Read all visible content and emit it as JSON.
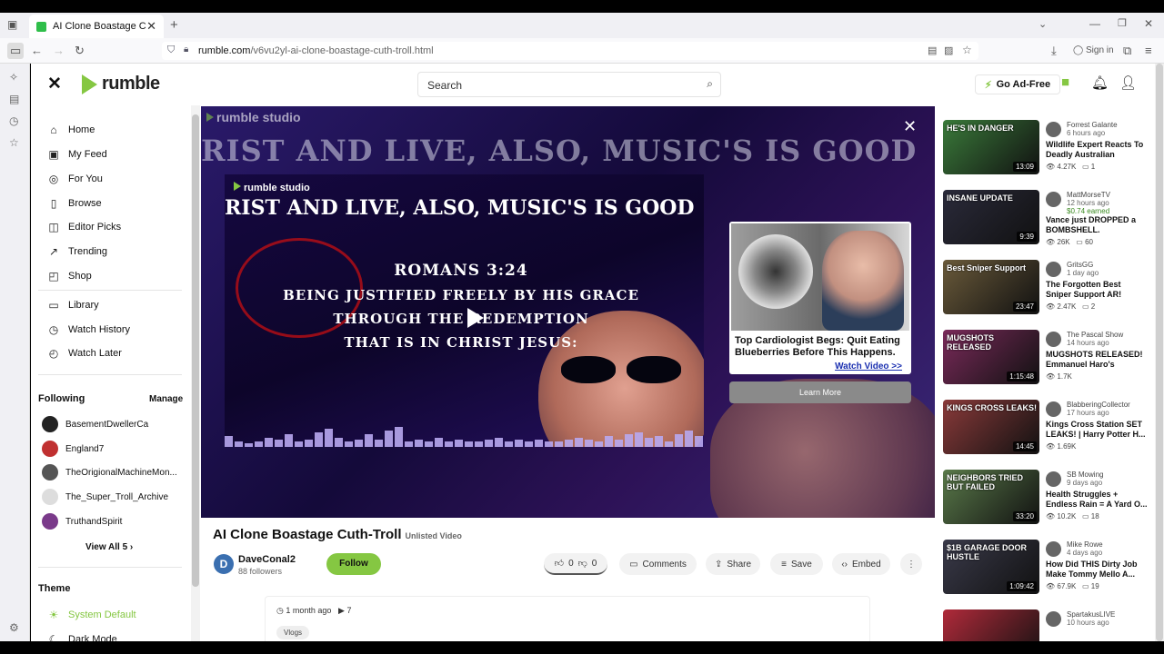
{
  "browser": {
    "tab_title": "AI Clone Boastage Cuth-Troll",
    "url_domain": "rumble.com",
    "url_path": "/v6vu2yl-ai-clone-boastage-cuth-troll.html",
    "sign_in": "Sign in"
  },
  "header": {
    "logo": "rumble",
    "search_placeholder": "Search",
    "ad_free": "Go Ad-Free"
  },
  "sidebar": {
    "nav": [
      "Home",
      "My Feed",
      "For You",
      "Browse",
      "Editor Picks",
      "Trending",
      "Shop"
    ],
    "library": [
      "Library",
      "Watch History",
      "Watch Later"
    ],
    "following_title": "Following",
    "manage": "Manage",
    "following": [
      "BasementDwellerCa",
      "England7",
      "TheOrigionalMachineMon...",
      "The_Super_Troll_Archive",
      "TruthandSpirit"
    ],
    "view_all": "View All 5",
    "theme_title": "Theme",
    "theme_options": [
      "System Default",
      "Dark Mode"
    ]
  },
  "video": {
    "studio_label": "rumble studio",
    "big_text": "RIST AND LIVE, ALSO, MUSIC'S IS GOOD",
    "inner_text": "RIST AND LIVE, ALSO, MUSIC'S IS GOOD",
    "verse_ref": "ROMANS 3:24",
    "verse_lines": [
      "BEING JUSTIFIED FREELY BY HIS GRACE",
      "THROUGH THE REDEMPTION",
      "THAT IS IN CHRIST JESUS:"
    ],
    "ad_headline": "Top Cardiologist Begs: Quit Eating Blueberries Before This Happens.",
    "ad_link": "Watch Video >>",
    "learn_more": "Learn More"
  },
  "details": {
    "title": "AI Clone Boastage Cuth-Troll",
    "unlisted": "Unlisted Video",
    "channel": "DaveConal2",
    "channel_initial": "D",
    "followers": "88 followers",
    "follow": "Follow",
    "likes": "0",
    "dislikes": "0",
    "comments": "Comments",
    "share": "Share",
    "save": "Save",
    "embed": "Embed",
    "date": "1 month ago",
    "views": "7",
    "tag": "Vlogs"
  },
  "related": [
    {
      "channel": "Forrest Galante",
      "ago": "6 hours ago",
      "earned": "",
      "title": "Wildlife Expert Reacts To Deadly Australian Anima...",
      "views": "4.27K",
      "comments": "1",
      "duration": "13:09",
      "thumb_text": "HE'S IN DANGER",
      "color": "#3a7a3a"
    },
    {
      "channel": "MattMorseTV",
      "ago": "12 hours ago",
      "earned": "$0.74 earned",
      "title": "Vance just DROPPED a BOMBSHELL.",
      "views": "26K",
      "comments": "60",
      "duration": "9:39",
      "thumb_text": "INSANE UPDATE",
      "color": "#2a2a3a"
    },
    {
      "channel": "GritsGG",
      "ago": "1 day ago",
      "earned": "",
      "title": "The Forgotten Best Sniper Support AR!",
      "views": "2.47K",
      "comments": "2",
      "duration": "23:47",
      "thumb_text": "Best Sniper Support",
      "color": "#6a5a3a"
    },
    {
      "channel": "The Pascal Show",
      "ago": "14 hours ago",
      "earned": "",
      "title": "MUGSHOTS RELEASED! Emmanuel Haro's Parent...",
      "views": "1.7K",
      "comments": "",
      "duration": "1:15:48",
      "thumb_text": "MUGSHOTS RELEASED",
      "color": "#7a2a5a"
    },
    {
      "channel": "BlabberingCollector",
      "ago": "17 hours ago",
      "earned": "",
      "title": "Kings Cross Station SET LEAKS! | Harry Potter H...",
      "views": "1.69K",
      "comments": "",
      "duration": "14:45",
      "thumb_text": "KINGS CROSS LEAKS!",
      "color": "#8a3a3a"
    },
    {
      "channel": "SB Mowing",
      "ago": "9 days ago",
      "earned": "",
      "title": "Health Struggles + Endless Rain = A Yard O...",
      "views": "10.2K",
      "comments": "18",
      "duration": "33:20",
      "thumb_text": "NEIGHBORS TRIED BUT FAILED",
      "color": "#5a7a4a"
    },
    {
      "channel": "Mike Rowe",
      "ago": "4 days ago",
      "earned": "",
      "title": "How Did THIS Dirty Job Make Tommy Mello A...",
      "views": "67.9K",
      "comments": "19",
      "duration": "1:09:42",
      "thumb_text": "$1B GARAGE DOOR HUSTLE",
      "color": "#3a3a4a"
    },
    {
      "channel": "SpartakusLIVE",
      "ago": "10 hours ago",
      "earned": "",
      "title": "",
      "views": "",
      "comments": "",
      "duration": "",
      "thumb_text": "",
      "color": "#b02a3a"
    }
  ]
}
